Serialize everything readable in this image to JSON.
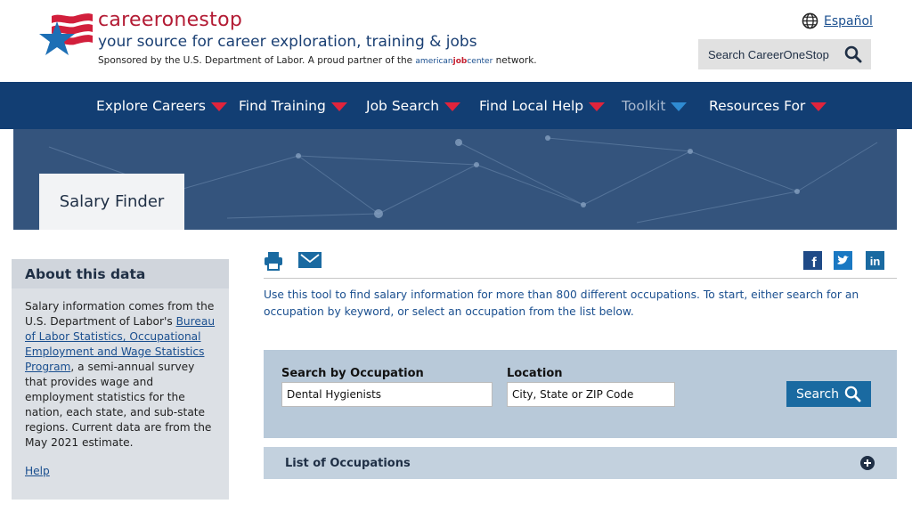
{
  "header": {
    "brand": "careeronestop",
    "tagline": "your source for career exploration, training & jobs",
    "sponsor_prefix": "Sponsored by the U.S. Department of Labor. A proud partner of the ",
    "sponsor_ajc_1": "american",
    "sponsor_ajc_2": "job",
    "sponsor_ajc_3": "center",
    "sponsor_suffix": " network.",
    "language_link": "Español",
    "search_label": "Search CareerOneStop",
    "logo_icon": "star-flag-logo-icon"
  },
  "nav": {
    "items": [
      {
        "label": "Explore Careers"
      },
      {
        "label": "Find Training"
      },
      {
        "label": "Job Search"
      },
      {
        "label": "Find Local Help"
      },
      {
        "label": "Toolkit"
      },
      {
        "label": "Resources For"
      }
    ]
  },
  "banner": {
    "title": "Salary Finder"
  },
  "sidebar": {
    "heading": "About this data",
    "text_1": "Salary information comes from the U.S. Department of Labor's ",
    "link": "Bureau of Labor Statistics, Occupational Employment and Wage Statistics Program",
    "text_2": ", a semi-annual survey that provides wage and employment statistics for the nation, each state, and sub-state regions. Current data are from the May 2021 estimate.",
    "help": "Help"
  },
  "main": {
    "intro": "Use this tool to find salary information for more than 800 different occupations. To start, either search for an occupation by keyword, or select an occupation from the list below.",
    "search": {
      "occupation_label": "Search by Occupation",
      "occupation_value": "Dental Hygienists",
      "location_label": "Location",
      "location_placeholder": "City, State or ZIP Code",
      "button_label": "Search"
    },
    "list_label": "List of Occupations"
  },
  "colors": {
    "nav_bg": "#123e73",
    "brand_red": "#b31b34",
    "accent_red": "#e0243c",
    "link_blue": "#1a4f8f",
    "panel_blue": "#b8c9d9"
  }
}
